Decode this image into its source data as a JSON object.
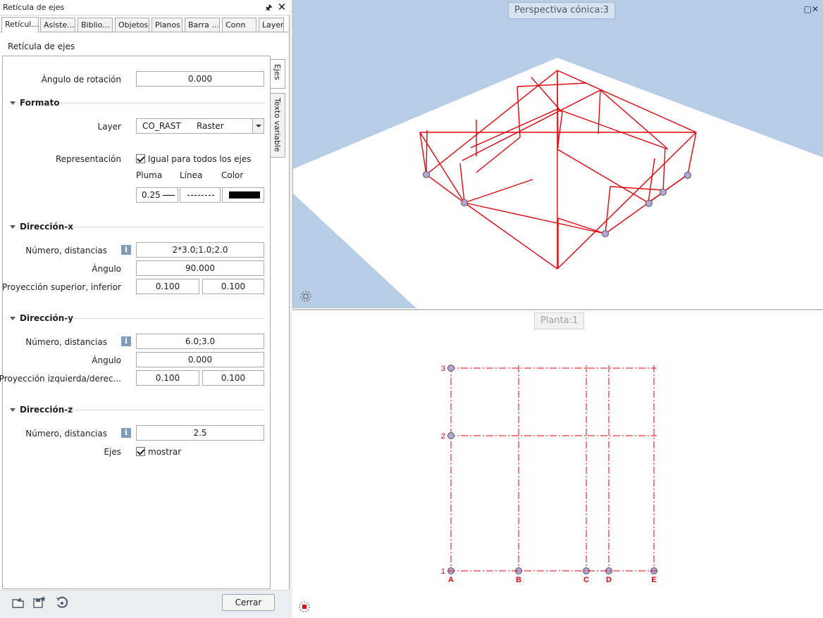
{
  "palette": {
    "title": "Retícula de ejes",
    "tabs": [
      "Retícul...",
      "Asiste...",
      "Biblio...",
      "Objetos",
      "Planos",
      "Barra ...",
      "Conn",
      "Layer"
    ],
    "section": "Retícula de ejes",
    "side_tabs": [
      "Ejes",
      "Texto variable"
    ],
    "rotation": {
      "label": "Ángulo de rotación",
      "value": "0.000"
    },
    "formato": {
      "header": "Formato",
      "layer_label": "Layer",
      "layer_code": "CO_RAST",
      "layer_name": "Raster",
      "rep_label": "Representación",
      "rep_check": "Igual para todos los ejes",
      "col_pluma": "Pluma",
      "col_linea": "Línea",
      "col_color": "Color",
      "pluma_value": "0.25",
      "color_hex": "#000000"
    },
    "dir_x": {
      "header": "Dirección-x",
      "num_label": "Número, distancias",
      "num_value": "2*3.0;1.0;2.0",
      "ang_label": "Ángulo",
      "ang_value": "90.000",
      "proj_label": "Proyección superior, inferior",
      "proj_a": "0.100",
      "proj_b": "0.100"
    },
    "dir_y": {
      "header": "Dirección-y",
      "num_label": "Número, distancias",
      "num_value": "6.0;3.0",
      "ang_label": "Ángulo",
      "ang_value": "0.000",
      "proj_label": "Proyección izquierda/derec...",
      "proj_a": "0.100",
      "proj_b": "0.100"
    },
    "dir_z": {
      "header": "Dirección-z",
      "num_label": "Número, distancias",
      "num_value": "2.5",
      "ejes_label": "Ejes",
      "ejes_check": "mostrar"
    },
    "close_button": "Cerrar"
  },
  "views": {
    "perspective_label": "Perspectiva cónica:3",
    "plan_label": "Planta:1",
    "grid_color": "#e8000b",
    "plan_x_labels": [
      "A",
      "B",
      "C",
      "D",
      "E"
    ],
    "plan_y_labels": [
      "1",
      "2",
      "3"
    ]
  }
}
